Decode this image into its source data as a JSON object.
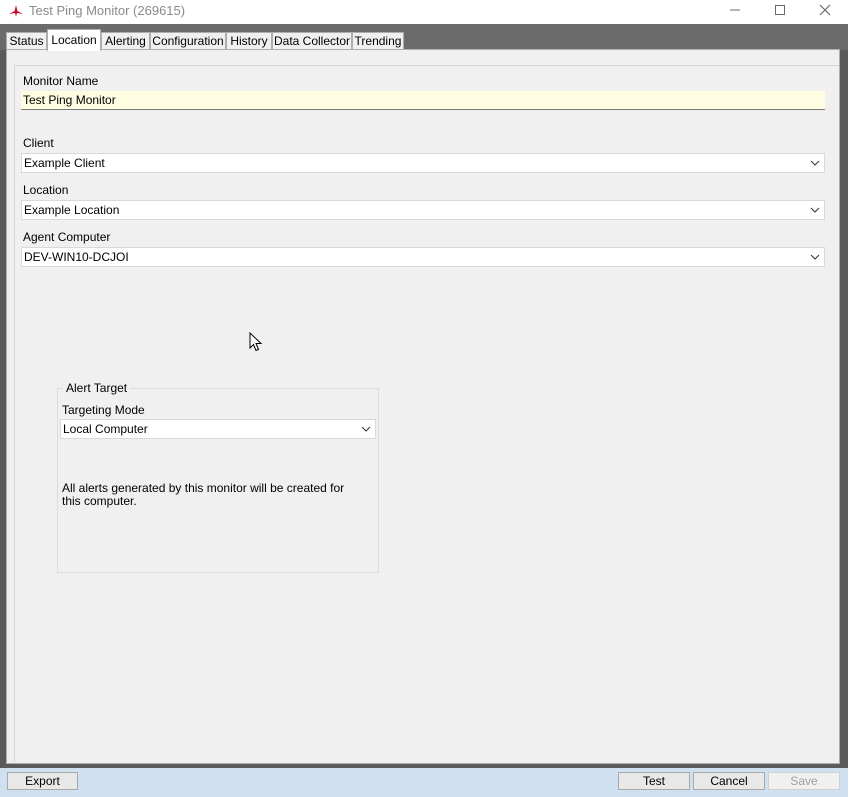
{
  "window": {
    "title": "Test Ping Monitor (269615)",
    "icon": "app-logo-icon"
  },
  "tabs": [
    {
      "label": "Status"
    },
    {
      "label": "Location",
      "active": true
    },
    {
      "label": "Alerting"
    },
    {
      "label": "Configuration"
    },
    {
      "label": "History"
    },
    {
      "label": "Data Collector"
    },
    {
      "label": "Trending"
    }
  ],
  "form": {
    "monitor_name": {
      "label": "Monitor Name",
      "value": "Test Ping Monitor"
    },
    "client": {
      "label": "Client",
      "value": "Example Client"
    },
    "location": {
      "label": "Location",
      "value": "Example Location"
    },
    "agent_computer": {
      "label": "Agent Computer",
      "value": "DEV-WIN10-DCJOI"
    }
  },
  "alert_target": {
    "group_label": "Alert Target",
    "targeting_mode_label": "Targeting Mode",
    "targeting_mode_value": "Local Computer",
    "info_text": "All alerts generated by this monitor will be created for this computer."
  },
  "buttons": {
    "export": "Export",
    "test": "Test",
    "cancel": "Cancel",
    "save": "Save"
  },
  "colors": {
    "name_field_bg": "#fffde1",
    "bottom_bar": "#cfe0f1",
    "tab_strip": "#6b6b6b"
  }
}
